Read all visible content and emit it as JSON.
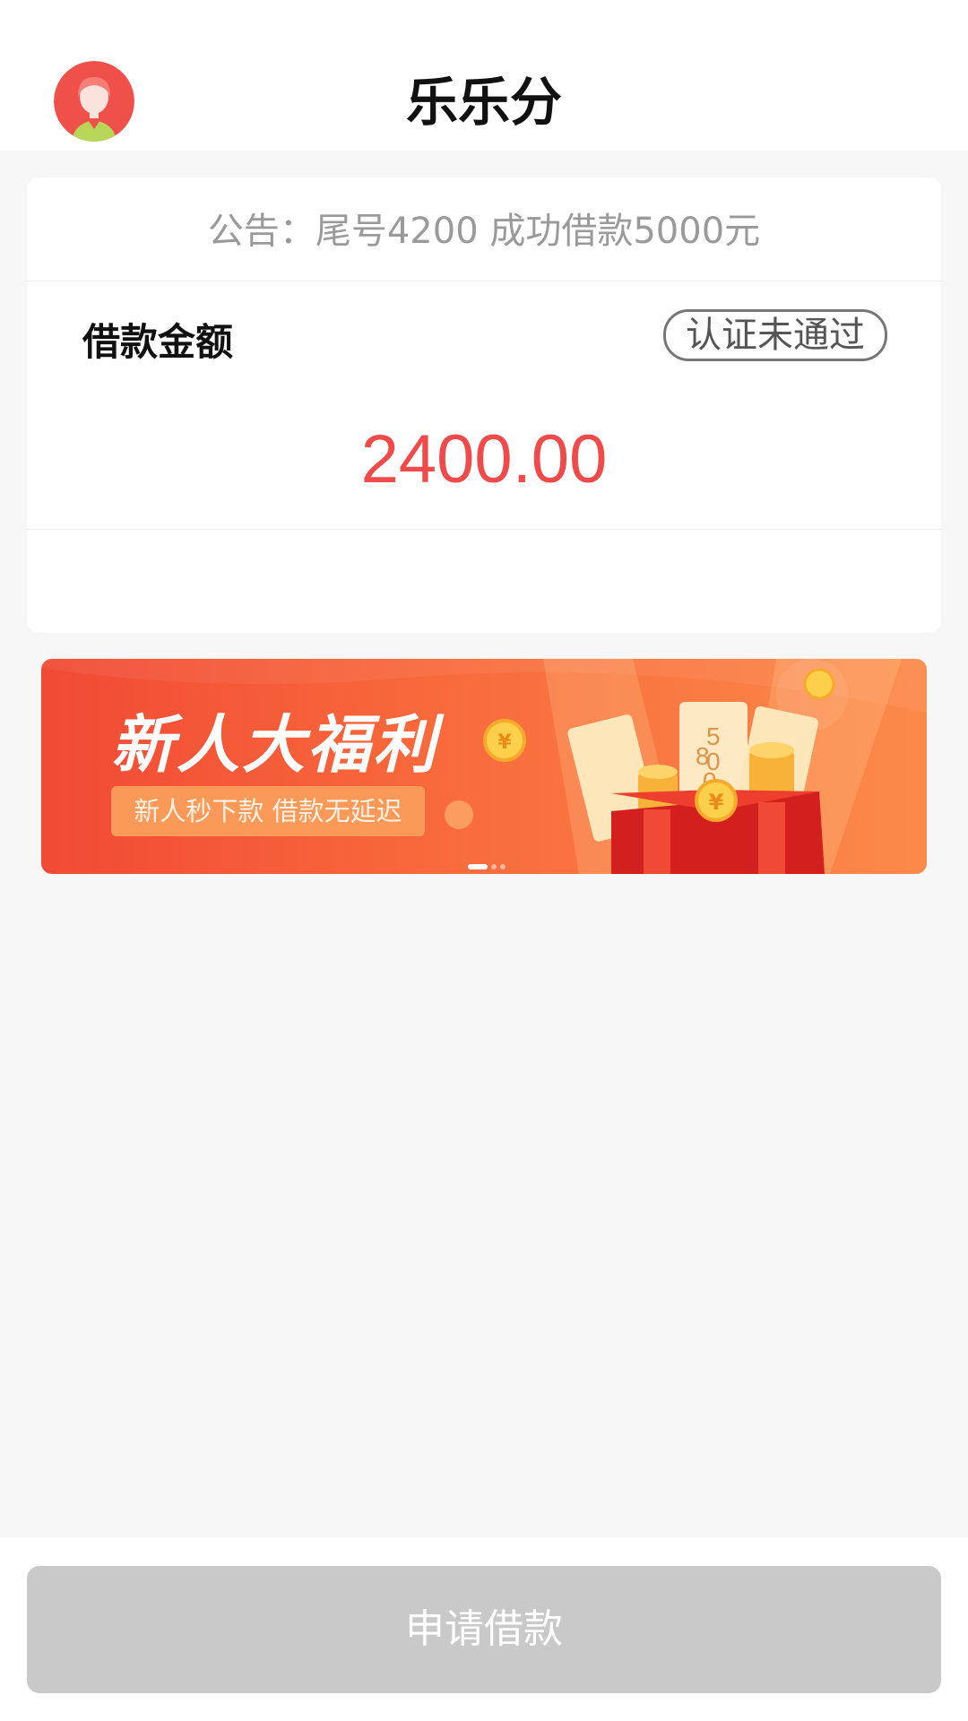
{
  "header": {
    "title": "乐乐分",
    "avatar_icon": "user-avatar-icon"
  },
  "loan_card": {
    "notice": "公告：尾号4200 成功借款5000元",
    "amount_label": "借款金额",
    "certification_status": "认证未通过",
    "amount_value": "2400.00"
  },
  "banner": {
    "title": "新人大福利",
    "subtitle": "新人秒下款  借款无延迟",
    "coupon_digits": [
      "8",
      "0",
      "5",
      "0",
      "6"
    ],
    "coin_symbol": "¥",
    "slides_total": 3,
    "active_slide": 1
  },
  "footer": {
    "apply_label": "申请借款"
  },
  "colors": {
    "accent_red": "#ef4b4b",
    "disabled_button": "#c9c9c9",
    "page_background": "#f7f7f7"
  }
}
